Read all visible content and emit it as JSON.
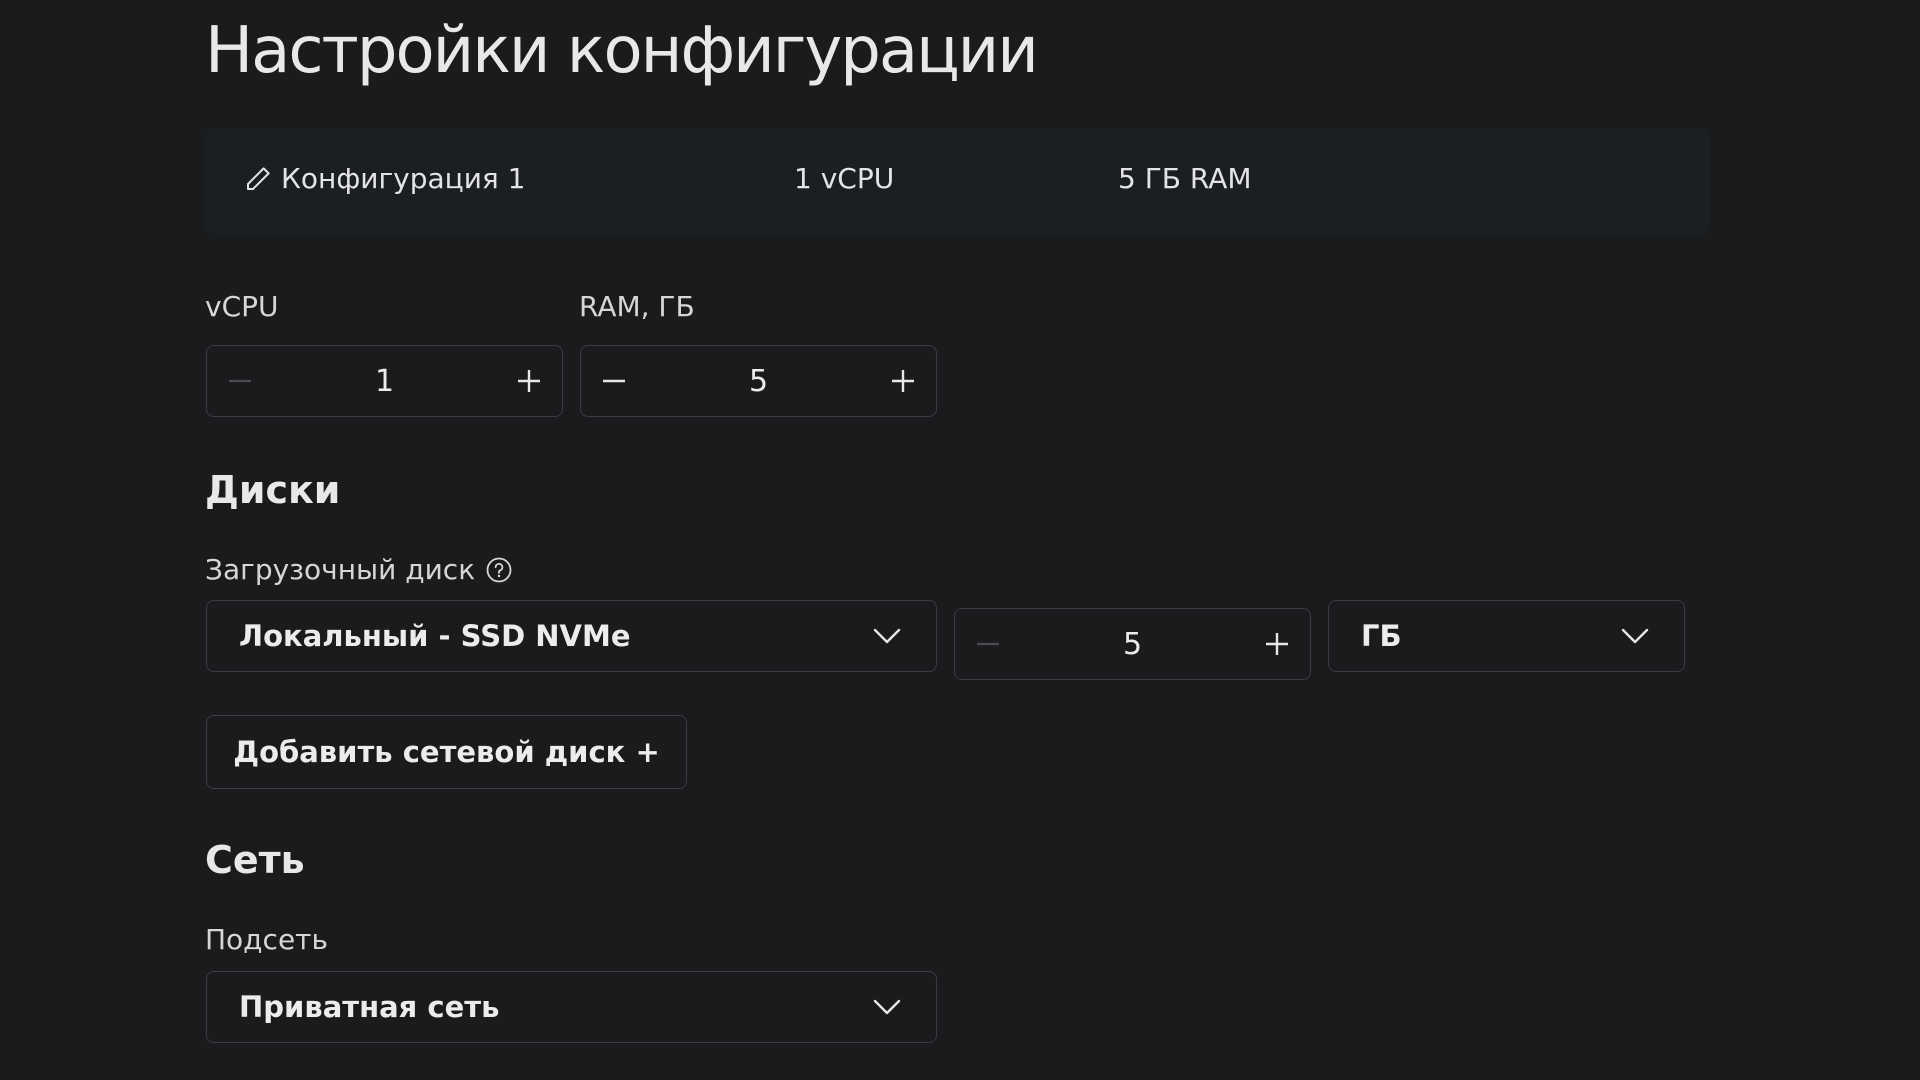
{
  "page": {
    "title": "Настройки конфигурации"
  },
  "summary": {
    "config_name": "Конфигурация 1",
    "cpu": "1 vCPU",
    "ram": "5 ГБ RAM",
    "edit_icon": "pencil-icon"
  },
  "compute": {
    "vcpu": {
      "label": "vCPU",
      "value": "1"
    },
    "ram": {
      "label": "RAM, ГБ",
      "value": "5"
    }
  },
  "disks": {
    "title": "Диски",
    "boot_label": "Загрузочный диск",
    "help_icon": "question-circle-icon",
    "disk_type": "Локальный - SSD NVMe",
    "size": "5",
    "unit": "ГБ",
    "add_button": "Добавить сетевой диск +"
  },
  "network": {
    "title": "Сеть",
    "subnet_label": "Подсеть",
    "subnet": "Приватная сеть"
  },
  "colors": {
    "background": "#1a1b1d",
    "summary_bg": "#1b1e22",
    "border": "#3a3c40",
    "text": "#e4e4e4",
    "disabled_icon": "#4a4c50"
  }
}
